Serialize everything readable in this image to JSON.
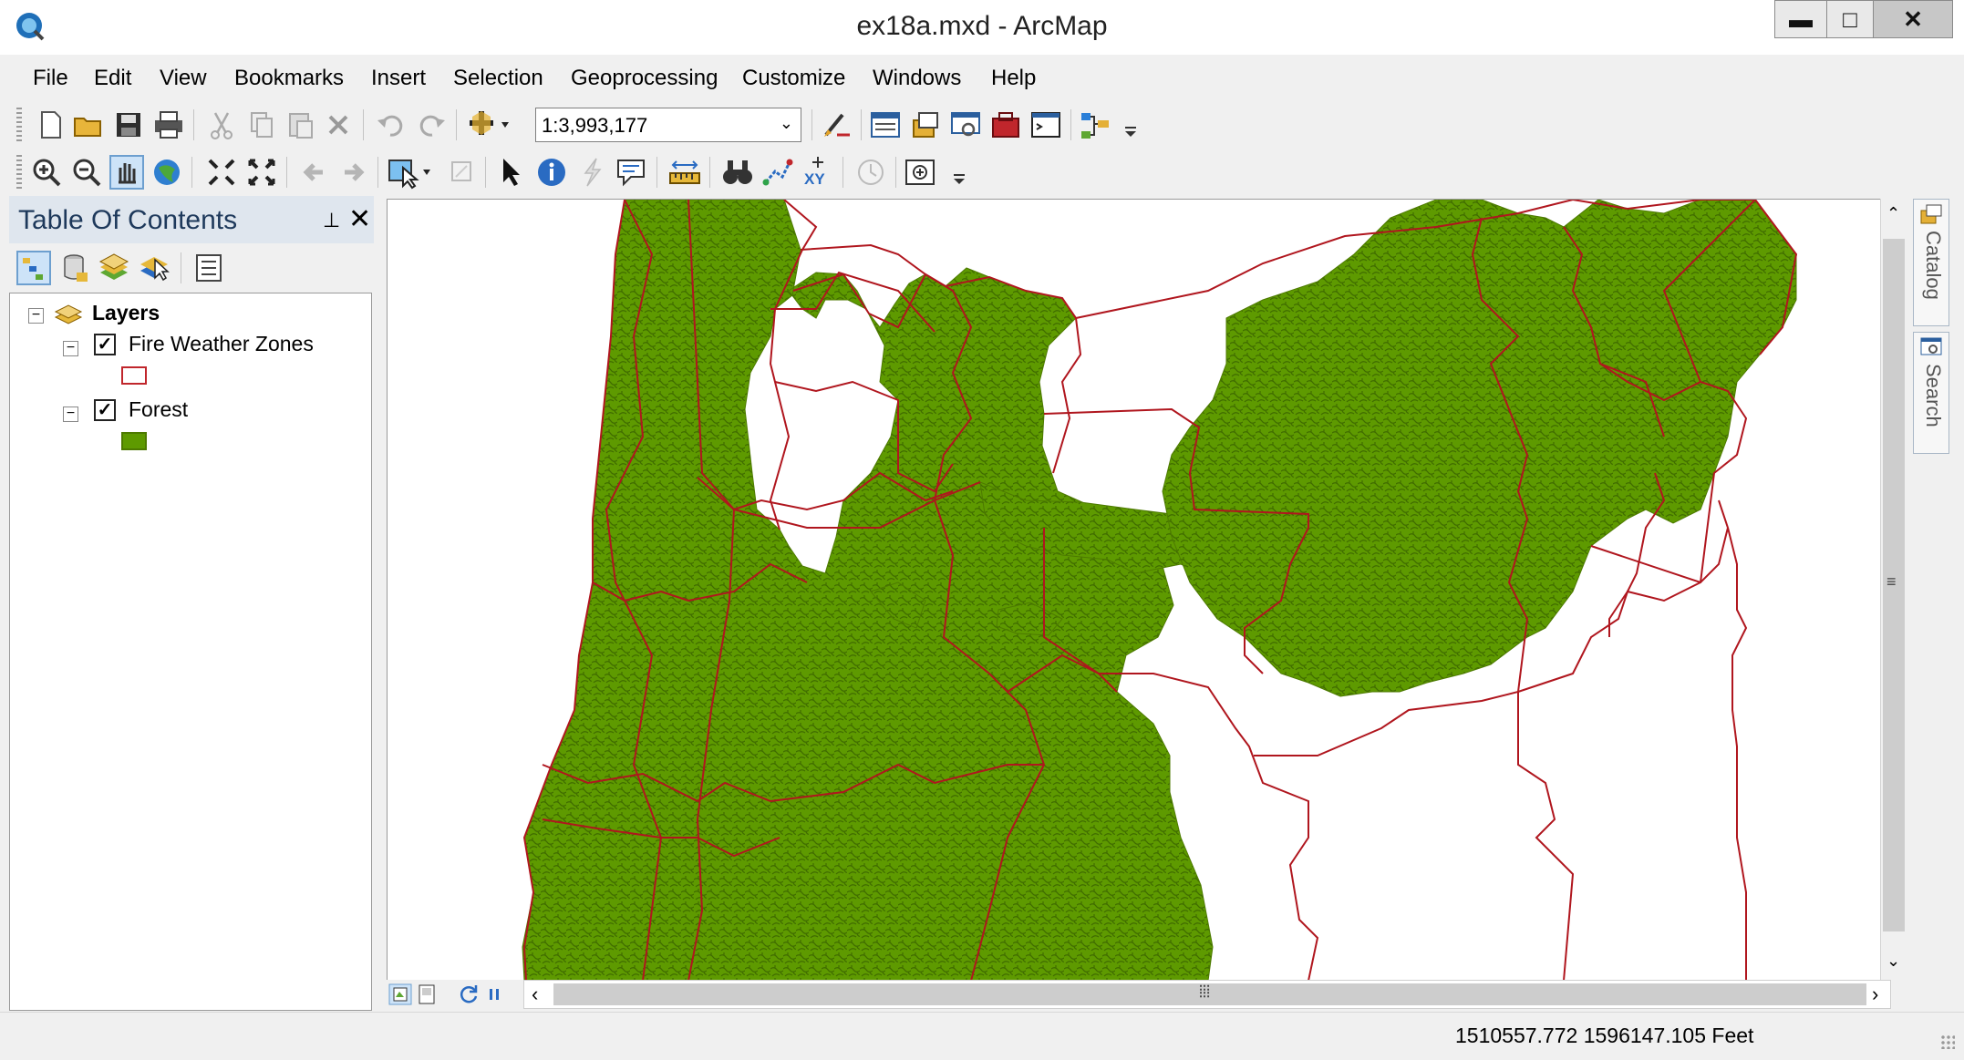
{
  "window": {
    "title": "ex18a.mxd - ArcMap",
    "min": "▬",
    "max": "□",
    "close": "✕"
  },
  "menu": [
    "File",
    "Edit",
    "View",
    "Bookmarks",
    "Insert",
    "Selection",
    "Geoprocessing",
    "Customize",
    "Windows",
    "Help"
  ],
  "standard_toolbar": {
    "scale": "1:3,993,177",
    "icons": [
      "new-document-icon",
      "open-icon",
      "save-icon",
      "print-icon",
      "cut-icon",
      "copy-icon",
      "paste-icon",
      "delete-icon",
      "undo-icon",
      "redo-icon",
      "add-data-icon",
      "editor-icon",
      "table-of-contents-icon",
      "catalog-icon",
      "search-window-icon",
      "arctoolbox-icon",
      "python-icon",
      "model-builder-icon"
    ]
  },
  "tools_toolbar": {
    "icons": [
      "zoom-in-icon",
      "zoom-out-icon",
      "pan-icon",
      "full-extent-icon",
      "fixed-zoom-in-icon",
      "fixed-zoom-out-icon",
      "go-back-icon",
      "go-forward-icon",
      "select-features-icon",
      "clear-selection-icon",
      "select-elements-icon",
      "identify-icon",
      "hyperlink-icon",
      "html-popup-icon",
      "measure-icon",
      "find-icon",
      "find-route-icon",
      "go-to-xy-icon",
      "time-slider-icon",
      "viewer-window-icon"
    ]
  },
  "toc": {
    "title": "Table Of Contents",
    "pin": "⊥",
    "close": "✕",
    "tabs": [
      "list-by-drawing-order-icon",
      "list-by-source-icon",
      "list-by-visibility-icon",
      "list-by-selection-icon",
      "options-icon"
    ],
    "root": "Layers",
    "layers": [
      {
        "name": "Fire Weather Zones",
        "checked": true,
        "swatch_fill": "#ffffff",
        "swatch_stroke": "#c0262c"
      },
      {
        "name": "Forest",
        "checked": true,
        "swatch_fill": "#5e9a00",
        "swatch_stroke": "#4d7a00"
      }
    ]
  },
  "dock": {
    "catalog": "Catalog",
    "search": "Search"
  },
  "status": {
    "coordinates": "1510557.772  1596147.105 Feet"
  },
  "colors": {
    "forest": "#5e9a00",
    "forest_dark": "#3f6b00",
    "zone_boundary": "#b0161e"
  }
}
